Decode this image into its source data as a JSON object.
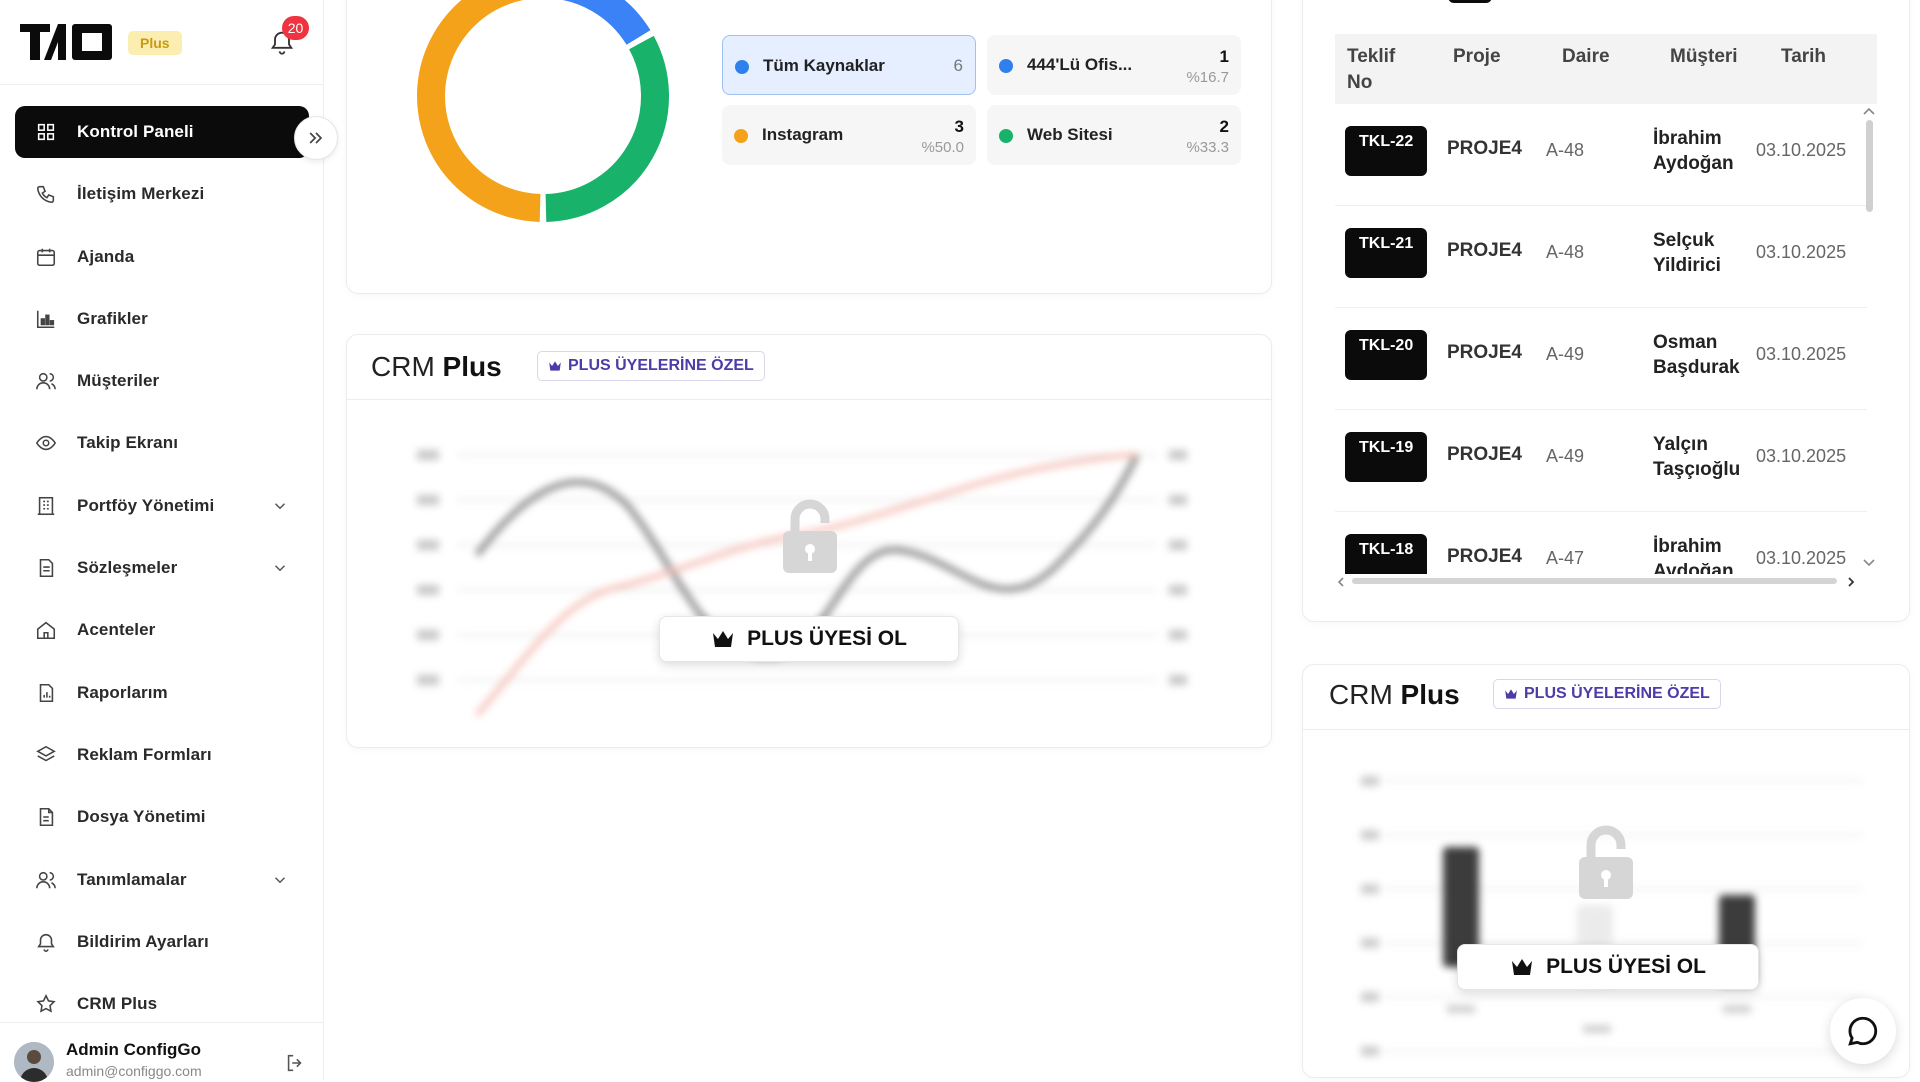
{
  "app": {
    "plus_badge": "Plus",
    "notification_count": "20"
  },
  "sidebar": {
    "items": [
      {
        "label": "Kontrol Paneli",
        "icon": "grid-icon",
        "active": true
      },
      {
        "label": "İletişim Merkezi",
        "icon": "phone-icon"
      },
      {
        "label": "Ajanda",
        "icon": "calendar-icon"
      },
      {
        "label": "Grafikler",
        "icon": "bar-chart-icon"
      },
      {
        "label": "Müşteriler",
        "icon": "users-icon"
      },
      {
        "label": "Takip Ekranı",
        "icon": "eye-icon"
      },
      {
        "label": "Portföy Yönetimi",
        "icon": "building-icon",
        "expandable": true
      },
      {
        "label": "Sözleşmeler",
        "icon": "document-icon",
        "expandable": true
      },
      {
        "label": "Acenteler",
        "icon": "home-icon"
      },
      {
        "label": "Raporlarım",
        "icon": "report-icon"
      },
      {
        "label": "Reklam Formları",
        "icon": "layers-icon"
      },
      {
        "label": "Dosya Yönetimi",
        "icon": "file-icon"
      },
      {
        "label": "Tanımlamalar",
        "icon": "users-icon",
        "expandable": true
      },
      {
        "label": "Bildirim Ayarları",
        "icon": "bell-icon"
      },
      {
        "label": "CRM Plus",
        "icon": "star-icon"
      }
    ],
    "user": {
      "name": "Admin ConfigGo",
      "email": "admin@configgo.com"
    }
  },
  "sources": {
    "items": [
      {
        "name": "Tüm Kaynaklar",
        "count": "6",
        "percent": "",
        "color": "#2f80ed"
      },
      {
        "name": "444'Lü Ofis...",
        "count": "1",
        "percent": "%16.7",
        "color": "#2f80ed"
      },
      {
        "name": "Instagram",
        "count": "3",
        "percent": "%50.0",
        "color": "#f5a21b"
      },
      {
        "name": "Web Sitesi",
        "count": "2",
        "percent": "%33.3",
        "color": "#18b26b"
      }
    ]
  },
  "chart_data": {
    "type": "pie",
    "categories": [
      "Instagram",
      "Web Sitesi",
      "444'Lü Ofis..."
    ],
    "values": [
      3,
      2,
      1
    ],
    "colors": [
      "#f5a21b",
      "#18b26b",
      "#3b82f6"
    ]
  },
  "crm_plus": {
    "title_prefix": "CRM",
    "title_bold": "Plus",
    "tag": "PLUS ÜYELERİNE ÖZEL",
    "cta": "PLUS ÜYESİ OL"
  },
  "offers_table": {
    "headers": [
      "Teklif No",
      "Proje",
      "Daire",
      "Müşteri",
      "Tarih"
    ],
    "rows": [
      {
        "no": "TKL-22",
        "proje": "PROJE4",
        "daire": "A-48",
        "musteri": "İbrahim Aydoğan",
        "tarih": "03.10.2025"
      },
      {
        "no": "TKL-21",
        "proje": "PROJE4",
        "daire": "A-48",
        "musteri": "Selçuk Yildirici",
        "tarih": "03.10.2025"
      },
      {
        "no": "TKL-20",
        "proje": "PROJE4",
        "daire": "A-49",
        "musteri": "Osman Başdurak",
        "tarih": "03.10.2025"
      },
      {
        "no": "TKL-19",
        "proje": "PROJE4",
        "daire": "A-49",
        "musteri": "Yalçın Taşçıoğlu",
        "tarih": "03.10.2025"
      },
      {
        "no": "TKL-18",
        "proje": "PROJE4",
        "daire": "A-47",
        "musteri": "İbrahim Aydoğan",
        "tarih": "03.10.2025"
      }
    ]
  }
}
